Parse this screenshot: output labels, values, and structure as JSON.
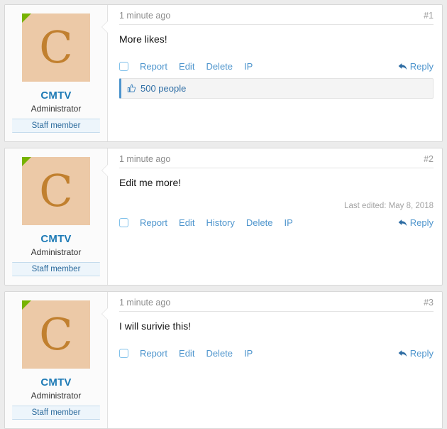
{
  "theme": {
    "page_background": "#ececec",
    "card_background": "#ffffff",
    "accent_blue": "#4e95cd",
    "username_blue": "#1f7bb6",
    "online_green": "#77b300",
    "avatar_background": "#ecc9a7",
    "avatar_letter_color": "#c1802f",
    "staff_badge_background": "#edf5fb"
  },
  "user": {
    "name": "CMTV",
    "title": "Administrator",
    "banner": "Staff member",
    "avatar_letter": "C",
    "online_indicator": "online-corner-marker"
  },
  "posts": [
    {
      "date": "1 minute ago",
      "number": "#1",
      "body": "More likes!",
      "edited": null,
      "actions": [
        "Report",
        "Edit",
        "Delete",
        "IP"
      ],
      "reply_label": "Reply",
      "likes": {
        "text": "500 people",
        "icon": "thumbs-up-icon"
      }
    },
    {
      "date": "1 minute ago",
      "number": "#2",
      "body": "Edit me more!",
      "edited": "Last edited: May 8, 2018",
      "actions": [
        "Report",
        "Edit",
        "History",
        "Delete",
        "IP"
      ],
      "reply_label": "Reply",
      "likes": null
    },
    {
      "date": "1 minute ago",
      "number": "#3",
      "body": "I will surivie this!",
      "edited": null,
      "actions": [
        "Report",
        "Edit",
        "Delete",
        "IP"
      ],
      "reply_label": "Reply",
      "likes": null
    }
  ]
}
